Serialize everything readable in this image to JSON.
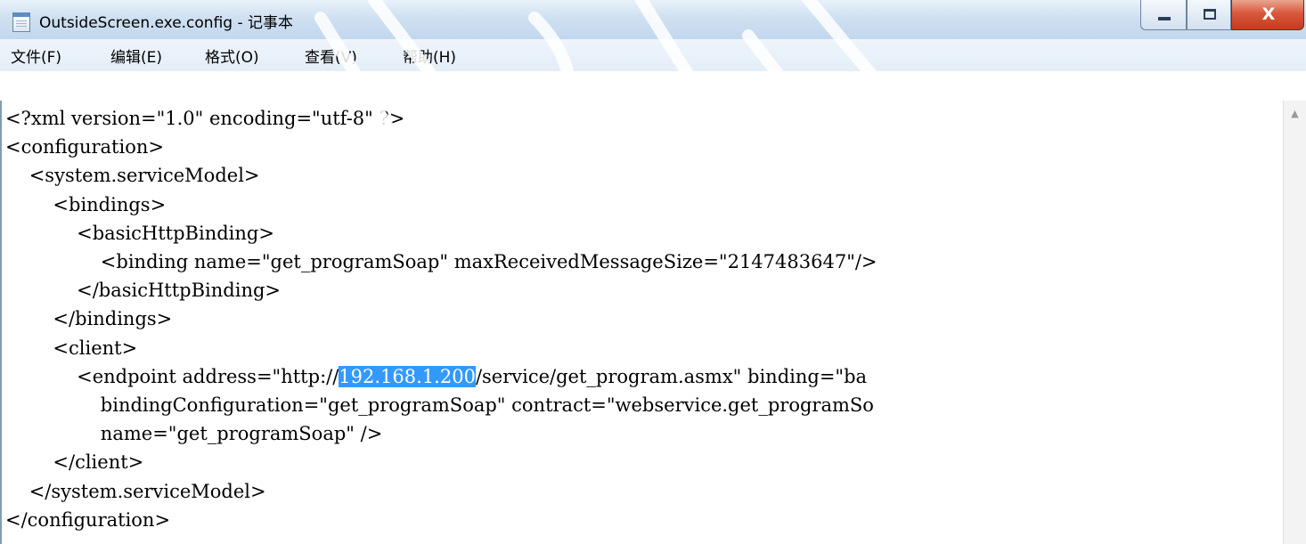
{
  "window": {
    "title": "OutsideScreen.exe.config - 记事本",
    "close_glyph": "X"
  },
  "menu": {
    "items": [
      {
        "label": "文件(F)"
      },
      {
        "label": "编辑(E)"
      },
      {
        "label": "格式(O)"
      },
      {
        "label": "查看(V)"
      },
      {
        "label": "帮助(H)"
      }
    ]
  },
  "editor": {
    "lines": [
      "<?xml version=\"1.0\" encoding=\"utf-8\" ?>",
      "<configuration>",
      "    <system.serviceModel>",
      "        <bindings>",
      "            <basicHttpBinding>",
      "                <binding name=\"get_programSoap\" maxReceivedMessageSize=\"2147483647\"/>",
      "            </basicHttpBinding>",
      "        </bindings>",
      "        <client>",
      "            <endpoint address=\"http://",
      "                bindingConfiguration=\"get_programSoap\" contract=\"webservice.get_programSo",
      "                name=\"get_programSoap\" />",
      "        </client>",
      "    </system.serviceModel>",
      "</configuration>"
    ],
    "selected_text": "192.168.1.200",
    "line_after_selection": "/service/get_program.asmx\" binding=\"ba"
  },
  "colors": {
    "selection": "#3399ff",
    "close_button": "#c43b1f",
    "titlebar": "#cfe0f1"
  },
  "icons": {
    "app": "notepad-icon",
    "minimize": "minimize-icon",
    "maximize": "maximize-icon",
    "close": "close-icon",
    "scroll_up": "scroll-up-arrow-icon"
  }
}
